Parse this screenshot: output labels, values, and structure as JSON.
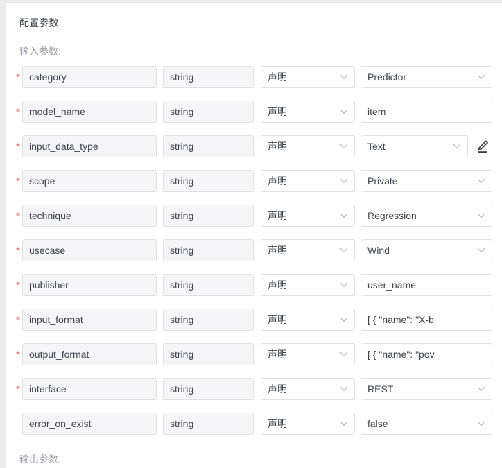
{
  "panel": {
    "title": "配置参数",
    "input_label": "输入参数:",
    "output_label": "输出参数:",
    "required_marker": "*"
  },
  "colors": {
    "required_star": "#e8493f",
    "field_border": "#e0e0e6",
    "field_filled_bg": "#f5f5f8",
    "text": "#41444f",
    "muted_text": "#9a9aa6",
    "page_bg": "#ececed",
    "card_bg": "#ffffff"
  },
  "icons": {
    "chevron": "chevron-down-icon",
    "edit": "pencil-edit-icon"
  },
  "input_params": [
    {
      "required": true,
      "name": "category",
      "type": "string",
      "mode": "声明",
      "value": "Predictor",
      "value_kind": "select",
      "has_edit": false
    },
    {
      "required": true,
      "name": "model_name",
      "type": "string",
      "mode": "声明",
      "value": "item",
      "value_kind": "input",
      "has_edit": false
    },
    {
      "required": true,
      "name": "input_data_type",
      "type": "string",
      "mode": "声明",
      "value": "Text",
      "value_kind": "select",
      "has_edit": true
    },
    {
      "required": true,
      "name": "scope",
      "type": "string",
      "mode": "声明",
      "value": "Private",
      "value_kind": "select",
      "has_edit": false
    },
    {
      "required": true,
      "name": "technique",
      "type": "string",
      "mode": "声明",
      "value": "Regression",
      "value_kind": "select",
      "has_edit": false
    },
    {
      "required": true,
      "name": "usecase",
      "type": "string",
      "mode": "声明",
      "value": "Wind",
      "value_kind": "select",
      "has_edit": false
    },
    {
      "required": true,
      "name": "publisher",
      "type": "string",
      "mode": "声明",
      "value": "user_name",
      "value_kind": "input",
      "has_edit": false
    },
    {
      "required": true,
      "name": "input_format",
      "type": "string",
      "mode": "声明",
      "value": "[    {      \"name\": \"X-b",
      "value_kind": "input",
      "has_edit": false
    },
    {
      "required": true,
      "name": "output_format",
      "type": "string",
      "mode": "声明",
      "value": "[    {      \"name\": \"pov",
      "value_kind": "input",
      "has_edit": false
    },
    {
      "required": true,
      "name": "interface",
      "type": "string",
      "mode": "声明",
      "value": "REST",
      "value_kind": "select",
      "has_edit": false
    },
    {
      "required": false,
      "name": "error_on_exist",
      "type": "string",
      "mode": "声明",
      "value": "false",
      "value_kind": "select",
      "has_edit": false
    }
  ]
}
